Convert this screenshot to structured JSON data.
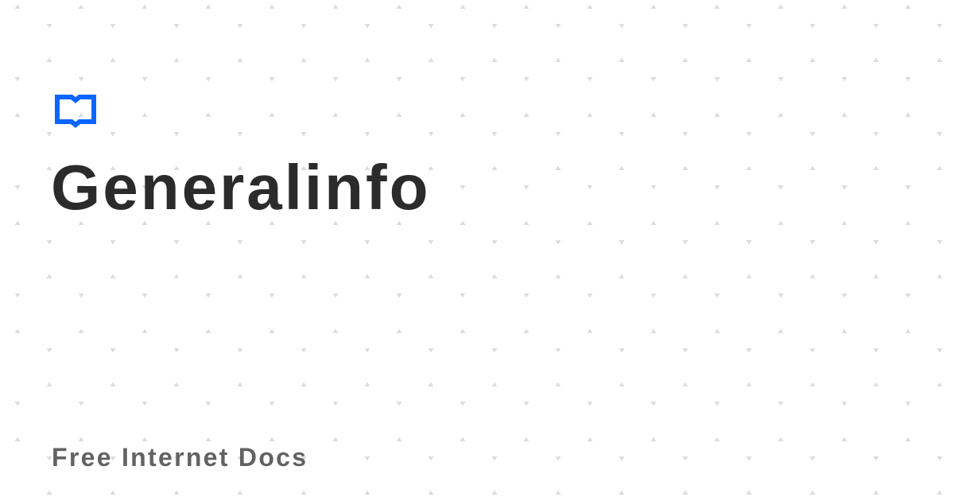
{
  "brand": {
    "logo_icon": "open-book-icon",
    "accent_color": "#0a66ff"
  },
  "title": "Generalinfo",
  "footer": "Free Internet Docs",
  "colors": {
    "title": "#2b2b2b",
    "footer": "#626262",
    "pattern": "#dadde1",
    "background": "#ffffff"
  }
}
